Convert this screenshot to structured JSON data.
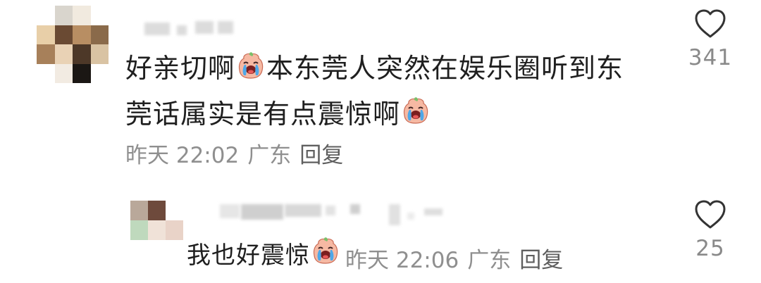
{
  "comment": {
    "text_line1": "好亲切啊",
    "text_line1b": "本东莞人突然在娱乐圈听到东",
    "text_line2": "莞话属实是有点震惊啊",
    "time": "昨天 22:02",
    "location": "广东",
    "reply_label": "回复",
    "like_count": "341",
    "emoji_icon": "crying-face-icon"
  },
  "reply": {
    "text": "我也好震惊",
    "time": "昨天 22:06",
    "location": "广东",
    "reply_label": "回复",
    "like_count": "25",
    "emoji_icon": "crying-face-icon"
  },
  "colors": {
    "meta_text": "#8f8f8f",
    "body_text": "#1f1f1f",
    "like_count": "#8a8a8a",
    "heart_stroke": "#333333"
  }
}
